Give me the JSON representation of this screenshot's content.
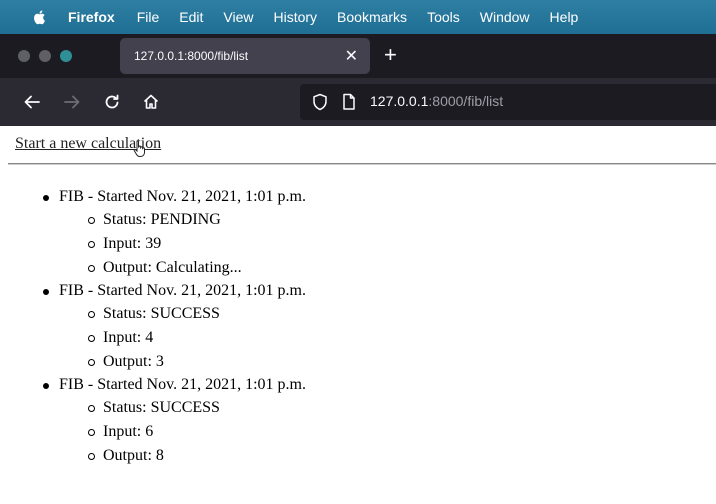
{
  "menubar": {
    "items": [
      "Firefox",
      "File",
      "Edit",
      "View",
      "History",
      "Bookmarks",
      "Tools",
      "Window",
      "Help"
    ]
  },
  "browser": {
    "tab_title": "127.0.0.1:8000/fib/list",
    "url_host": "127.0.0.1",
    "url_rest": ":8000/fib/list"
  },
  "page": {
    "link_label": "Start a new calculation",
    "tasks": [
      {
        "title": "FIB - Started Nov. 21, 2021, 1:01 p.m.",
        "status": "Status: PENDING",
        "input": "Input: 39",
        "output": "Output: Calculating..."
      },
      {
        "title": "FIB - Started Nov. 21, 2021, 1:01 p.m.",
        "status": "Status: SUCCESS",
        "input": "Input: 4",
        "output": "Output: 3"
      },
      {
        "title": "FIB - Started Nov. 21, 2021, 1:01 p.m.",
        "status": "Status: SUCCESS",
        "input": "Input: 6",
        "output": "Output: 8"
      }
    ]
  },
  "colors": {
    "menubar": "#1f6f95",
    "tabstrip": "#1c1b22",
    "active_tab": "#42414d",
    "navbar": "#2b2a33"
  }
}
